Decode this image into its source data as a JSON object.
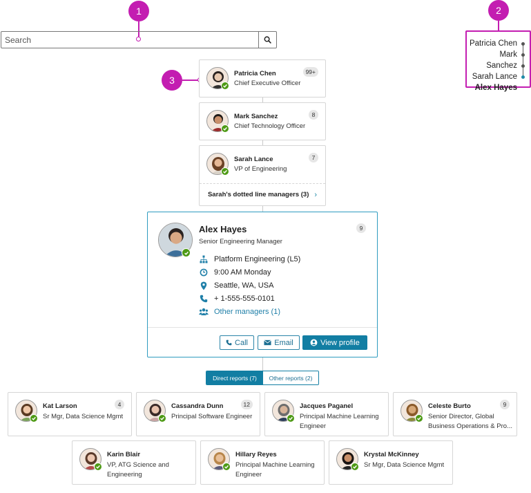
{
  "callouts": [
    "1",
    "2",
    "3"
  ],
  "search": {
    "placeholder": "Search",
    "button_icon": "search-icon"
  },
  "breadcrumb": {
    "items": [
      "Patricia Chen",
      "Mark Sanchez",
      "Sarah Lance",
      "Alex Hayes"
    ]
  },
  "chain": [
    {
      "name": "Patricia Chen",
      "title": "Chief Executive Officer",
      "count": "99+",
      "skin": "#e8c9b0",
      "hair": "#2b2320",
      "shirt": "#2f2f2f"
    },
    {
      "name": "Mark Sanchez",
      "title": "Chief Technology Officer",
      "count": "8",
      "skin": "#c98f6a",
      "hair": "#1e1a17",
      "shirt": "#9b2b2b"
    },
    {
      "name": "Sarah Lance",
      "title": "VP of Engineering",
      "count": "7",
      "skin": "#e5b896",
      "hair": "#6b4226",
      "shirt": "#d9d2c8",
      "dotted_label": "Sarah's dotted line managers (3)"
    }
  ],
  "focus": {
    "name": "Alex Hayes",
    "title": "Senior Engineering Manager",
    "count": "9",
    "skin": "#d9a884",
    "hair": "#2a2220",
    "shirt": "#3d6f9a",
    "org": "Platform Engineering (L5)",
    "time": "9:00 AM Monday",
    "location": "Seattle, WA, USA",
    "phone": "+ 1-555-555-0101",
    "other_managers": "Other managers (1)",
    "call_label": "Call",
    "email_label": "Email",
    "view_profile_label": "View profile"
  },
  "reports_toggle": {
    "direct": "Direct reports (7)",
    "other": "Other reports (2)"
  },
  "reports": [
    {
      "name": "Kat Larson",
      "title": "Sr Mgr, Data Science Mgmt",
      "count": "4",
      "skin": "#f0c8a8",
      "hair": "#5a3a22",
      "shirt": "#7aa35a"
    },
    {
      "name": "Cassandra Dunn",
      "title": "Principal Software Engineer",
      "count": "12",
      "skin": "#e9c3ae",
      "hair": "#3a2a28",
      "shirt": "#c9a3a3"
    },
    {
      "name": "Jacques Paganel",
      "title": "Principal Machine Learning Engineer",
      "count": "",
      "skin": "#d8b49a",
      "hair": "#6d6d6d",
      "shirt": "#2c3e5a"
    },
    {
      "name": "Celeste Burto",
      "title": "Senior Director, Global Business Operations & Pro...",
      "count": "9",
      "skin": "#d7a878",
      "hair": "#8a5a2a",
      "shirt": "#8a8a3a"
    },
    {
      "name": "Karin Blair",
      "title": "VP, ATG Science and Engineering",
      "count": "",
      "skin": "#edc8b2",
      "hair": "#5a3a2a",
      "shirt": "#b34a4a"
    },
    {
      "name": "Hillary Reyes",
      "title": "Principal Machine Learning Engineer",
      "count": "",
      "skin": "#e8bf98",
      "hair": "#b8864a",
      "shirt": "#5a5a7a"
    },
    {
      "name": "Krystal McKinney",
      "title": "Sr Mgr, Data Science Mgmt",
      "count": "",
      "skin": "#c9906a",
      "hair": "#1a1412",
      "shirt": "#222222"
    }
  ]
}
